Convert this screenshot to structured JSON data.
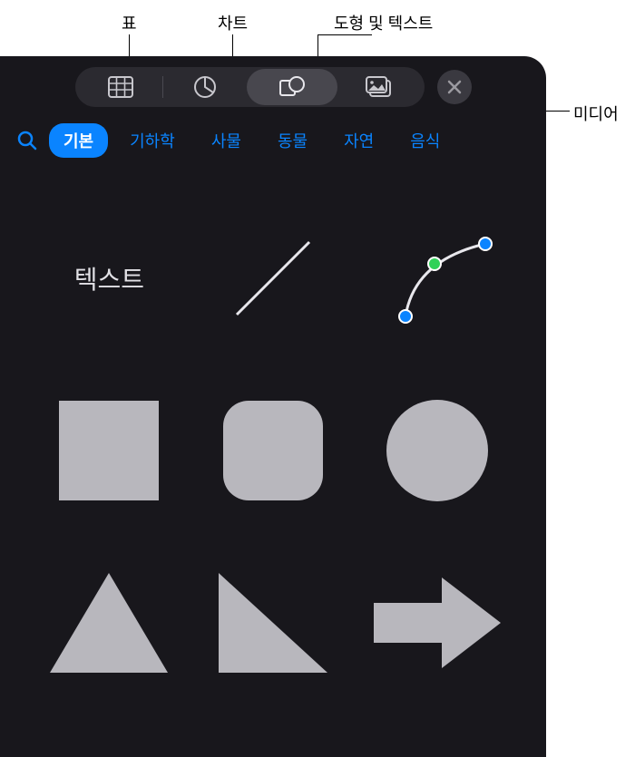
{
  "annotations": {
    "table": "표",
    "chart": "차트",
    "shapes_text": "도형 및 텍스트",
    "media": "미디어"
  },
  "toolbar": {
    "table_btn": "table-icon",
    "chart_btn": "chart-icon",
    "shapes_btn": "shapes-icon",
    "media_btn": "media-icon",
    "close_btn": "close-icon"
  },
  "categories": {
    "search": "search",
    "items": [
      {
        "label": "기본",
        "active": true
      },
      {
        "label": "기하학",
        "active": false
      },
      {
        "label": "사물",
        "active": false
      },
      {
        "label": "동물",
        "active": false
      },
      {
        "label": "자연",
        "active": false
      },
      {
        "label": "음식",
        "active": false
      }
    ]
  },
  "shapes": {
    "text_label": "텍스트",
    "items": [
      {
        "name": "text"
      },
      {
        "name": "line"
      },
      {
        "name": "curve-pen"
      },
      {
        "name": "square"
      },
      {
        "name": "rounded-square"
      },
      {
        "name": "circle"
      },
      {
        "name": "triangle"
      },
      {
        "name": "right-triangle"
      },
      {
        "name": "arrow"
      }
    ]
  },
  "colors": {
    "accent": "#0a84ff",
    "shape_fill": "#b8b7bd"
  }
}
